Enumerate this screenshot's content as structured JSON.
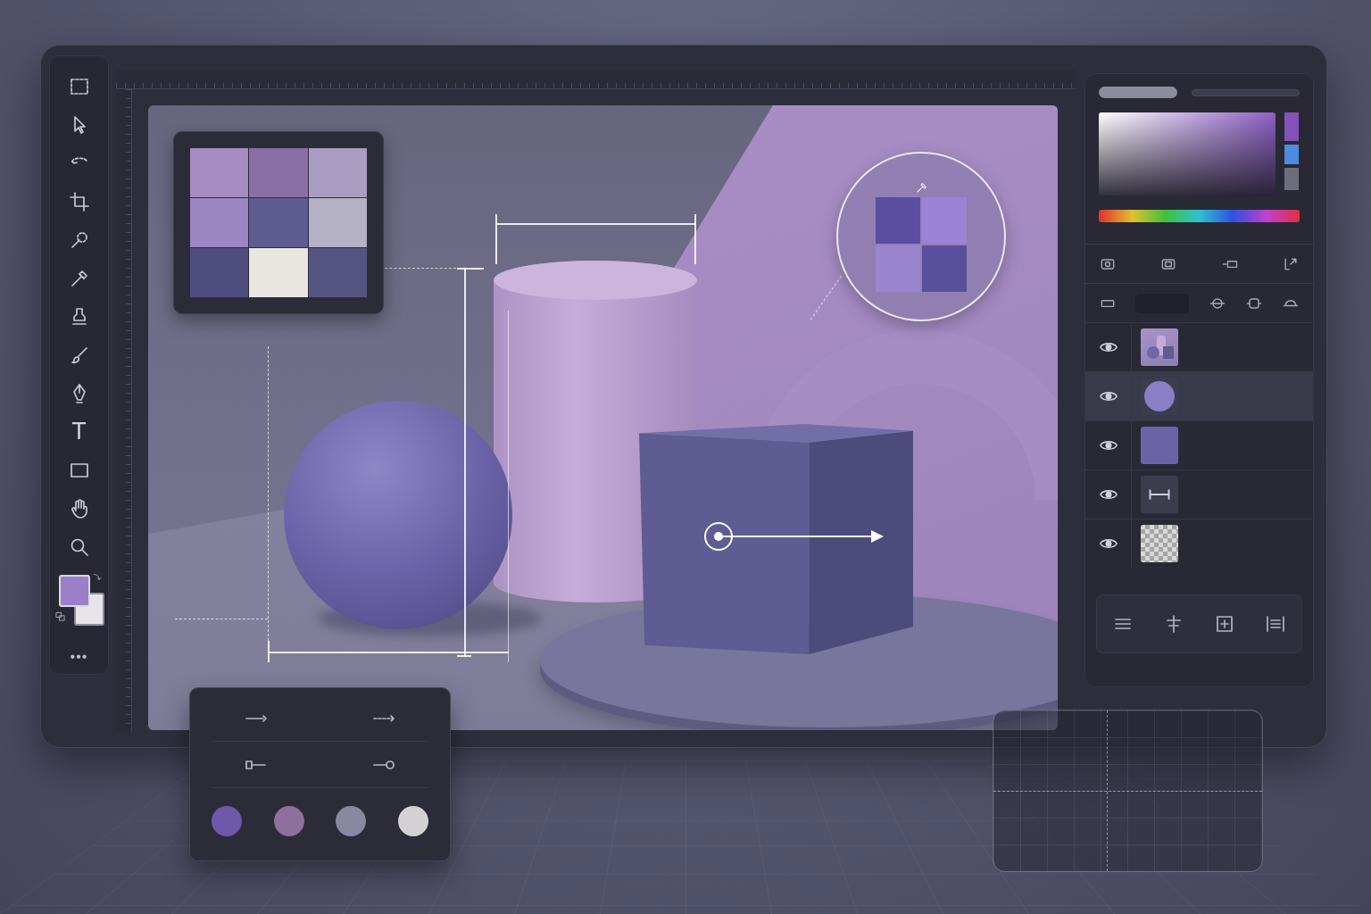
{
  "toolbar": {
    "type_tool": "T",
    "more": "•••",
    "foreground_color": "#9b80c9",
    "background_color": "#e7e5ea"
  },
  "canvas": {
    "swatches": [
      {
        "color": "#a68cc1"
      },
      {
        "color": "#8a6ea6"
      },
      {
        "color": "#a99dc1"
      },
      {
        "color": "#9c86c3"
      },
      {
        "color": "#5f5b93"
      },
      {
        "color": "#b4b1c6"
      },
      {
        "color": "#4f4d7f"
      },
      {
        "color": "#e9e6e2"
      },
      {
        "color": "#555481"
      }
    ],
    "loupe": [
      {
        "color": "#5b4ea1"
      },
      {
        "color": "#9d83d6"
      },
      {
        "color": "#9a86cf"
      },
      {
        "color": "#5a4f9b"
      }
    ]
  },
  "color_picker": {
    "color": "#8e5fc6"
  },
  "layers": [
    {
      "kind": "image",
      "visible": true,
      "selected": false
    },
    {
      "kind": "circle",
      "visible": true,
      "selected": true
    },
    {
      "kind": "square",
      "visible": true,
      "selected": false
    },
    {
      "kind": "measure",
      "visible": true,
      "selected": false
    },
    {
      "kind": "transparent",
      "visible": true,
      "selected": false
    }
  ],
  "stroke_panel": {
    "palette": [
      {
        "color": "#6e58a8"
      },
      {
        "color": "#8e6f9e"
      },
      {
        "color": "#8a87a0"
      },
      {
        "color": "#d4d1d5"
      }
    ]
  }
}
